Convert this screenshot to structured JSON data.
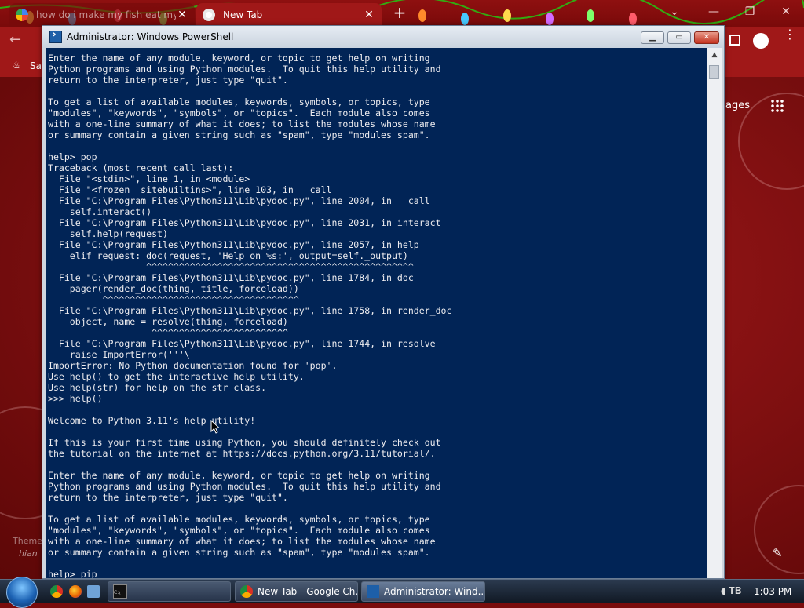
{
  "browser": {
    "tabs": [
      {
        "title": "how do i make my fish eat my c"
      },
      {
        "title": "New Tab"
      }
    ],
    "bookmark_partial": "Sa",
    "images_link_partial": "ages",
    "theme_text_partial": "Theme",
    "author_text_partial": "hian"
  },
  "powershell": {
    "title": "Administrator: Windows PowerShell",
    "console_lines": [
      "Enter the name of any module, keyword, or topic to get help on writing",
      "Python programs and using Python modules.  To quit this help utility and",
      "return to the interpreter, just type \"quit\".",
      "",
      "To get a list of available modules, keywords, symbols, or topics, type",
      "\"modules\", \"keywords\", \"symbols\", or \"topics\".  Each module also comes",
      "with a one-line summary of what it does; to list the modules whose name",
      "or summary contain a given string such as \"spam\", type \"modules spam\".",
      "",
      "help> pop",
      "Traceback (most recent call last):",
      "  File \"<stdin>\", line 1, in <module>",
      "  File \"<frozen _sitebuiltins>\", line 103, in __call__",
      "  File \"C:\\Program Files\\Python311\\Lib\\pydoc.py\", line 2004, in __call__",
      "    self.interact()",
      "  File \"C:\\Program Files\\Python311\\Lib\\pydoc.py\", line 2031, in interact",
      "    self.help(request)",
      "  File \"C:\\Program Files\\Python311\\Lib\\pydoc.py\", line 2057, in help",
      "    elif request: doc(request, 'Help on %s:', output=self._output)",
      "                  ^^^^^^^^^^^^^^^^^^^^^^^^^^^^^^^^^^^^^^^^^^^^^^^^^",
      "  File \"C:\\Program Files\\Python311\\Lib\\pydoc.py\", line 1784, in doc",
      "    pager(render_doc(thing, title, forceload))",
      "          ^^^^^^^^^^^^^^^^^^^^^^^^^^^^^^^^^^^^",
      "  File \"C:\\Program Files\\Python311\\Lib\\pydoc.py\", line 1758, in render_doc",
      "    object, name = resolve(thing, forceload)",
      "                   ^^^^^^^^^^^^^^^^^^^^^^^^^",
      "  File \"C:\\Program Files\\Python311\\Lib\\pydoc.py\", line 1744, in resolve",
      "    raise ImportError('''\\",
      "ImportError: No Python documentation found for 'pop'.",
      "Use help() to get the interactive help utility.",
      "Use help(str) for help on the str class.",
      ">>> help()",
      "",
      "Welcome to Python 3.11's help utility!",
      "",
      "If this is your first time using Python, you should definitely check out",
      "the tutorial on the internet at https://docs.python.org/3.11/tutorial/.",
      "",
      "Enter the name of any module, keyword, or topic to get help on writing",
      "Python programs and using Python modules.  To quit this help utility and",
      "return to the interpreter, just type \"quit\".",
      "",
      "To get a list of available modules, keywords, symbols, or topics, type",
      "\"modules\", \"keywords\", \"symbols\", or \"topics\".  Each module also comes",
      "with a one-line summary of what it does; to list the modules whose name",
      "or summary contain a given string such as \"spam\", type \"modules spam\".",
      "",
      "help> pip"
    ]
  },
  "taskbar": {
    "buttons": [
      {
        "label": ""
      },
      {
        "label": "New Tab - Google Ch..."
      },
      {
        "label": "Administrator: Wind..."
      }
    ],
    "clock": "1:03 PM"
  },
  "colors": {
    "console_bg": "#012456",
    "console_fg": "#eeedf0",
    "browser_theme": "#a01818"
  }
}
